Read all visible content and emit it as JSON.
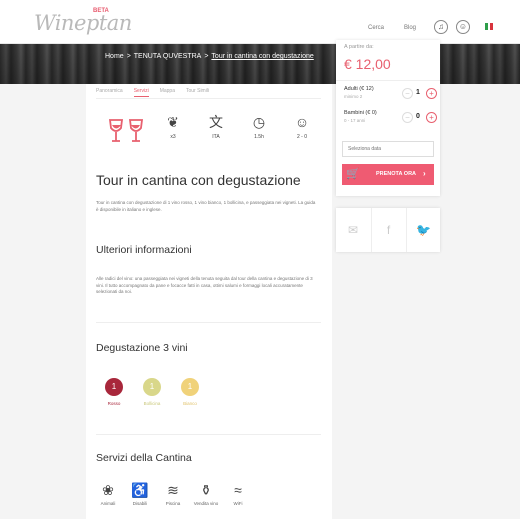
{
  "header": {
    "logo": "Wineptan",
    "beta": "BETA",
    "nav": [
      "Cerca",
      "Blog"
    ],
    "bell_icon": "bell-icon",
    "user_icon": "user-icon",
    "flag_colors": [
      "#2e9e4a",
      "#ffffff",
      "#d8343d"
    ]
  },
  "breadcrumb": [
    "Home",
    "TENUTA QUVESTRA",
    "Tour in cantina con degustazione"
  ],
  "tabs": [
    "Panoramica",
    "Servizi",
    "Mappa",
    "Tour Simili"
  ],
  "features": [
    {
      "icon": "grape-icon",
      "label": "x3"
    },
    {
      "icon": "translate-icon",
      "label": "ITA"
    },
    {
      "icon": "clock-icon",
      "label": "1.5h"
    },
    {
      "icon": "people-icon",
      "label": "2 - 0"
    }
  ],
  "title": "Tour in cantina con degustazione",
  "intro": "Tour in cantina con degustazione di 1 vino rosso, 1 vino bianco, 1 bollicina, e passeggiata nei vigneti. La guida è disponibile in italiano e inglese.",
  "more_info": {
    "heading": "Ulteriori informazioni",
    "text": "Alle radici del vino: una passeggiata nei vigneti della tenuta seguita dal tour della cantina e degustazione di 3 vini. Il tutto accompagnato da pane e focacce fatti in casa, ottimi salumi e formaggi locali accuratamente selezionati da noi."
  },
  "degustazione": {
    "heading": "Degustazione 3 vini",
    "wines": [
      {
        "count": "1",
        "label": "Rosso",
        "color": "#a8273b"
      },
      {
        "count": "1",
        "label": "Bollicina",
        "color": "#d9d78a"
      },
      {
        "count": "1",
        "label": "Bianco",
        "color": "#f0d27a"
      }
    ]
  },
  "servizi": {
    "heading": "Servizi della Cantina",
    "items": [
      {
        "icon": "paw-icon",
        "label": "Animali"
      },
      {
        "icon": "wheelchair-icon",
        "label": "Disabili"
      },
      {
        "icon": "pool-icon",
        "label": "Piscina"
      },
      {
        "icon": "shop-icon",
        "label": "Vendita vino"
      },
      {
        "icon": "wifi-icon",
        "label": "WiFi"
      }
    ]
  },
  "booking": {
    "from_label": "A partire da:",
    "price": "€ 12,00",
    "adults_label": "Adulti (€ 12)",
    "adults_sub": "minimo 2",
    "adults_count": "1",
    "children_label": "Bambini (€ 0)",
    "children_sub": "0 - 17 anni",
    "children_count": "0",
    "date_placeholder": "Seleziona data",
    "book_label": "PRENOTA ORA",
    "accent": "#ef5b72"
  },
  "share": [
    "mail-icon",
    "facebook-icon",
    "twitter-icon"
  ]
}
